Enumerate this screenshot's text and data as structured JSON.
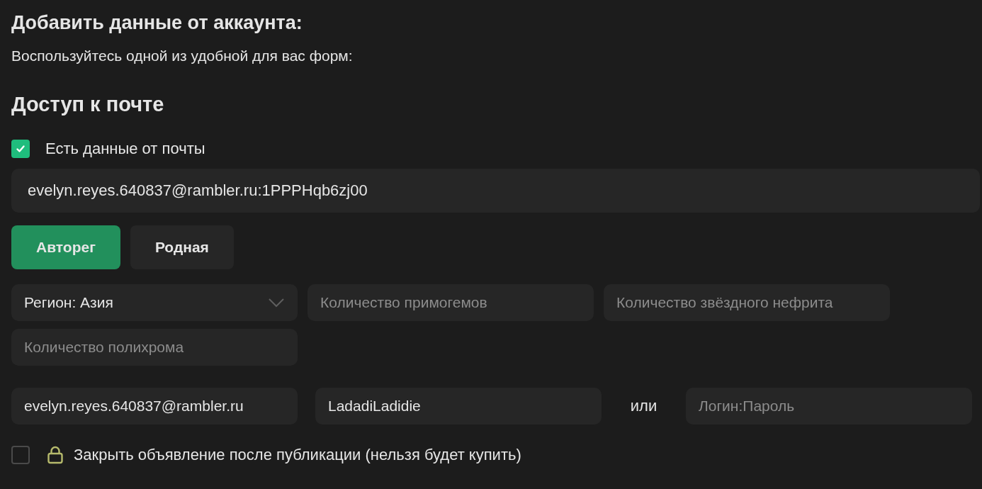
{
  "title": "Добавить данные от аккаунта:",
  "subtitle": "Воспользуйтесь одной из удобной для вас форм:",
  "section_title": "Доступ к почте",
  "mail_checkbox": {
    "label": "Есть данные от почты",
    "checked": true
  },
  "mail_field": {
    "value": "evelyn.reyes.640837@rambler.ru:1PPPHqb6zj00"
  },
  "mail_type_buttons": [
    {
      "label": "Авторег",
      "selected": true
    },
    {
      "label": "Родная",
      "selected": false
    }
  ],
  "fields": [
    {
      "kind": "select",
      "value": "Регион: Азия"
    },
    {
      "kind": "input",
      "placeholder": "Количество примогемов"
    },
    {
      "kind": "input",
      "placeholder": "Количество звёздного нефрита"
    },
    {
      "kind": "input",
      "placeholder": "Количество полихрома"
    }
  ],
  "login_row": {
    "fields": [
      {
        "value": "evelyn.reyes.640837@rambler.ru"
      },
      {
        "value": "LadadiLadidie"
      }
    ],
    "separator": "или",
    "alt_field": {
      "placeholder": "Логин:Пароль"
    }
  },
  "close_checkbox": {
    "label": "Закрыть объявление после публикации (нельзя будет купить)",
    "checked": false
  }
}
